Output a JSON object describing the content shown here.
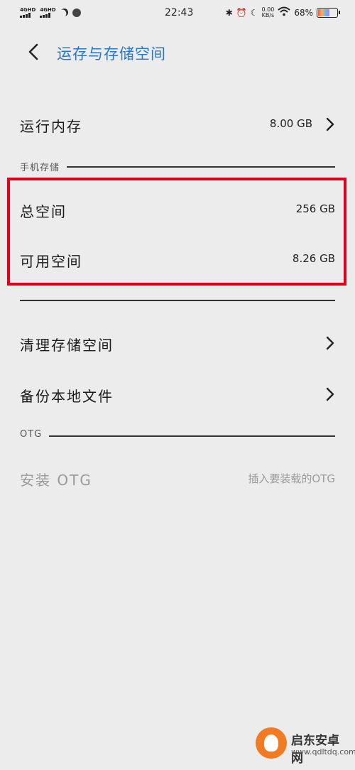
{
  "status_bar": {
    "sim1": "4GHD",
    "sim2": "4GHD",
    "time": "22:43",
    "speed_value": "0.00",
    "speed_unit": "KB/s",
    "battery": "68%",
    "battery_level": 0.68
  },
  "header": {
    "title": "运存与存储空间"
  },
  "ram": {
    "label": "运行内存",
    "value": "8.00 GB"
  },
  "phone_storage": {
    "section_title": "手机存储",
    "total": {
      "label": "总空间",
      "value": "256 GB"
    },
    "available": {
      "label": "可用空间",
      "value": "8.26 GB"
    }
  },
  "actions": {
    "clean": {
      "label": "清理存储空间"
    },
    "backup": {
      "label": "备份本地文件"
    }
  },
  "otg": {
    "section_title": "OTG",
    "install": {
      "label": "安装 OTG",
      "value": "插入要装载的OTG"
    }
  },
  "watermark": {
    "name": "启东安卓网",
    "url": "www.qdltdq.com"
  },
  "colors": {
    "accent": "#2a77c9",
    "highlight": "#e0001b",
    "background": "#ececec"
  }
}
